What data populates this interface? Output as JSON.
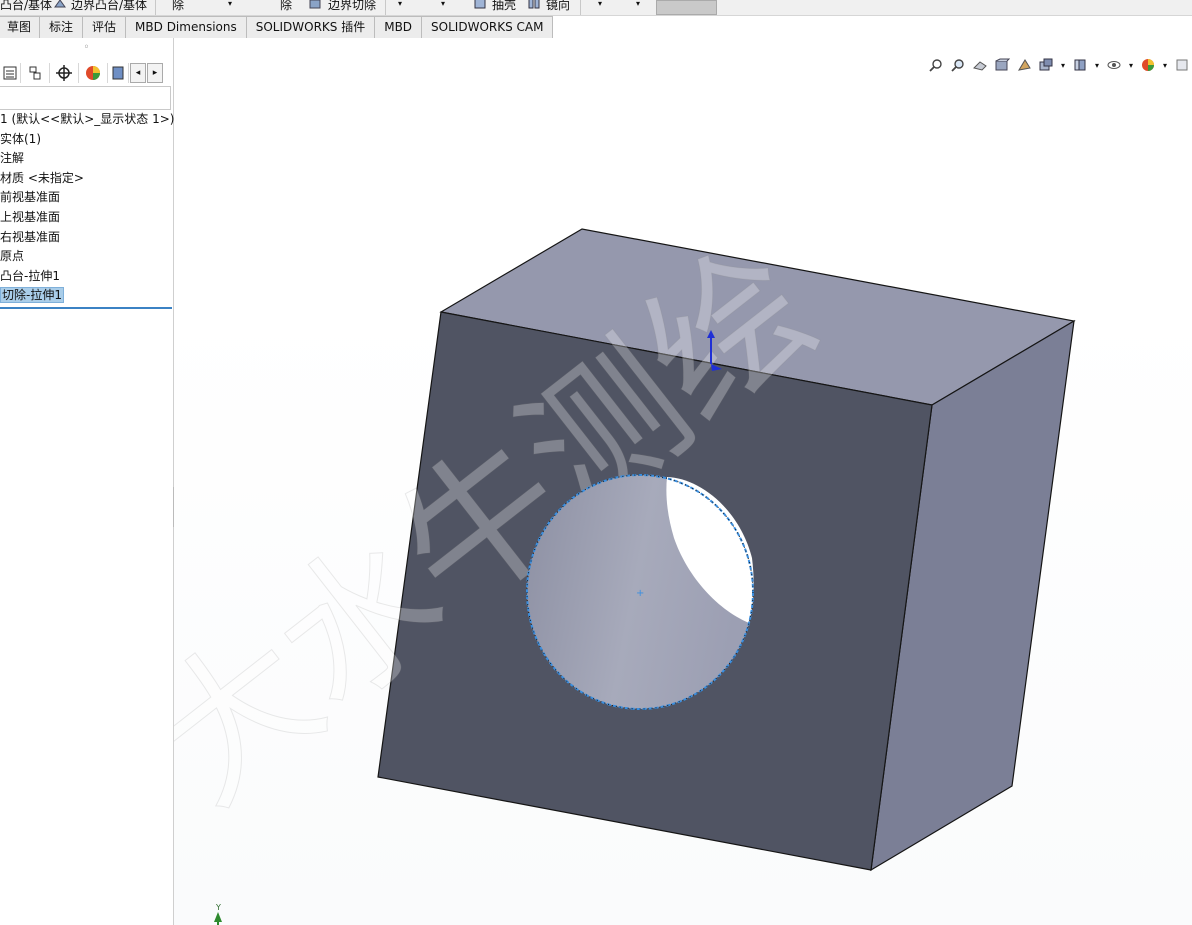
{
  "toolbar": {
    "item1": "凸台/基体",
    "item2": "边界凸台/基体",
    "item3": "除",
    "item4": "除",
    "item5": "边界切除",
    "item6": "抽壳",
    "item7": "镜向"
  },
  "tabs": [
    "草图",
    "标注",
    "评估",
    "MBD Dimensions",
    "SOLIDWORKS 插件",
    "MBD",
    "SOLIDWORKS CAM"
  ],
  "panel": {
    "dots": "◦",
    "tree": [
      "1  (默认<<默认>_显示状态 1>)",
      "实体(1)",
      "注解",
      "材质 <未指定>",
      "前视基准面",
      "上视基准面",
      "右视基准面",
      "原点",
      "凸台-拉伸1",
      "切除-拉伸1"
    ]
  },
  "viewport": {
    "watermark": "大水牛测绘",
    "axis_label": "Y"
  },
  "colors": {
    "front_face": "#505463",
    "top_face": "#9598ad",
    "side_face": "#7b7f96",
    "selection": "#3b8fe0"
  }
}
